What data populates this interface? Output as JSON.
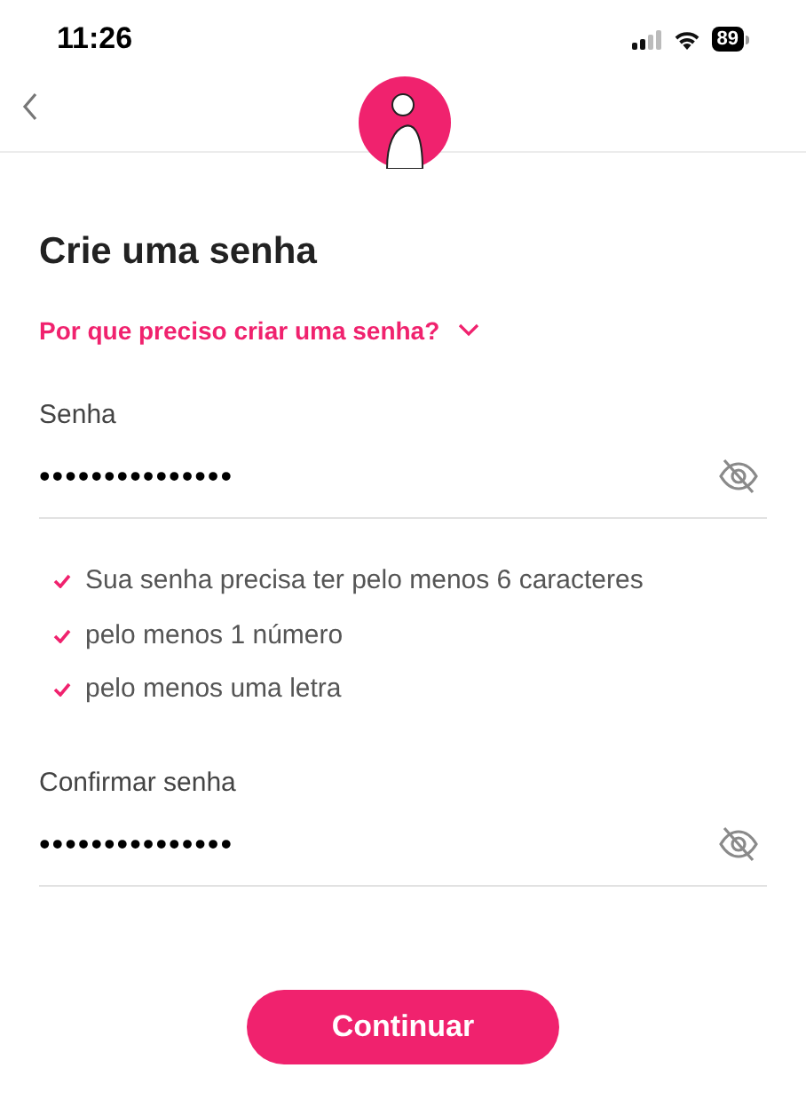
{
  "status_bar": {
    "time": "11:26",
    "battery": "89"
  },
  "title": "Crie uma senha",
  "help_link": {
    "label": "Por que preciso criar uma senha?",
    "expanded": false
  },
  "password": {
    "label": "Senha",
    "value": "•••••••••••••••",
    "visible": false
  },
  "requirements": [
    {
      "text": "Sua senha precisa ter pelo menos 6 caracteres",
      "checked": true
    },
    {
      "text": "pelo menos 1 número",
      "checked": true
    },
    {
      "text": "pelo menos uma letra",
      "checked": true
    }
  ],
  "confirm_password": {
    "label": "Confirmar senha",
    "value": "•••••••••••••••",
    "visible": false
  },
  "button": "Continuar"
}
